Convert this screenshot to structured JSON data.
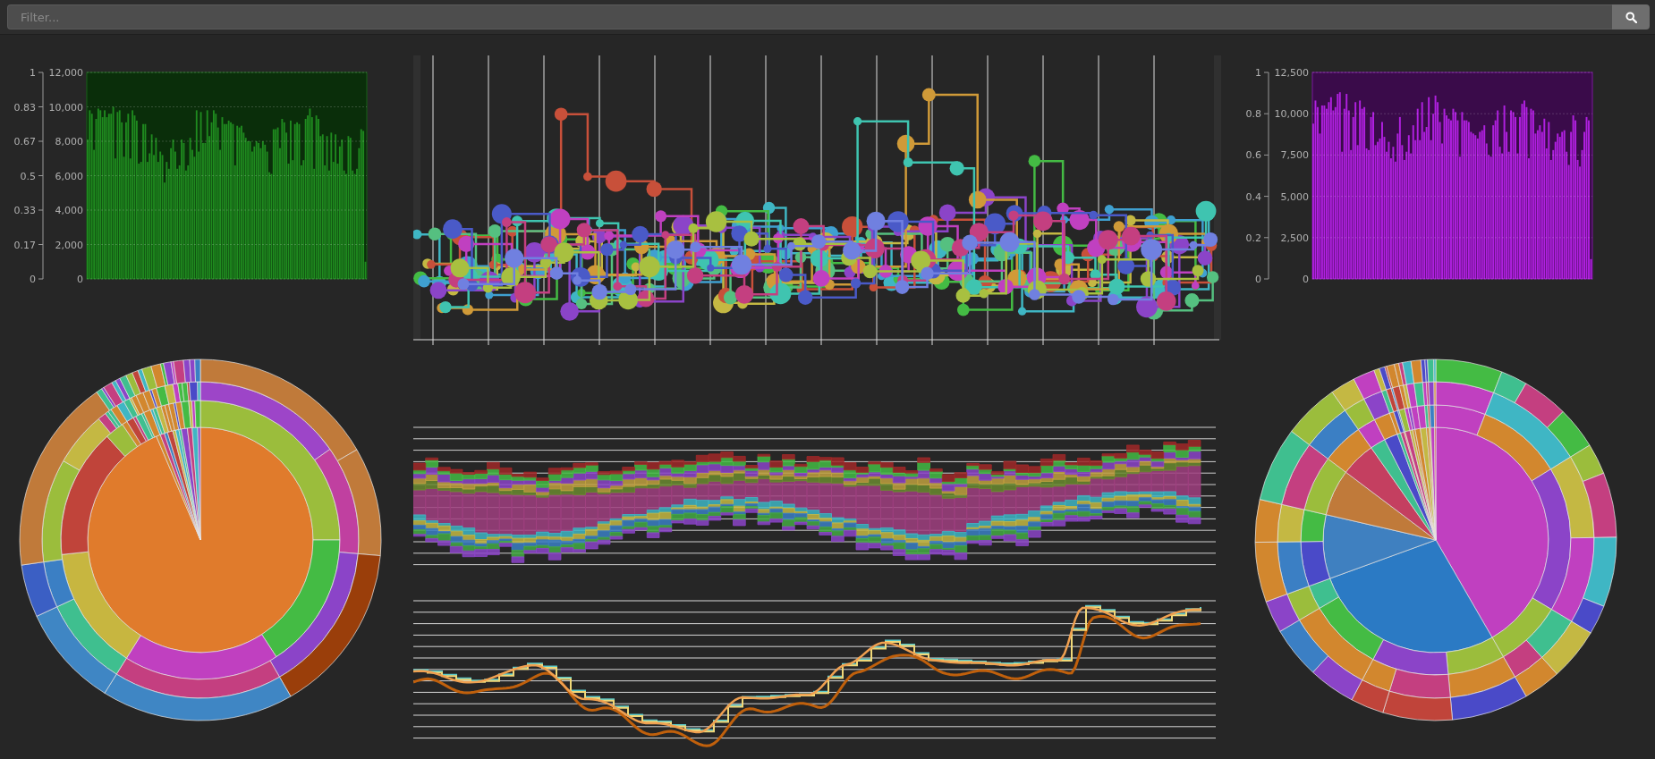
{
  "filter_bar": {
    "placeholder": "Filter..."
  },
  "bar_charts": [
    {
      "secondary_axis": {
        "ticks": [
          "1",
          "0.83",
          "0.67",
          "0.5",
          "0.33",
          "0.17",
          "0"
        ]
      },
      "chart_data": {
        "type": "bar",
        "grid": true,
        "ylim": [
          0,
          12000
        ],
        "yticks": [
          0,
          {
            "value": 2000,
            "label": "2,000"
          },
          {
            "value": 4000,
            "label": "4,000"
          },
          {
            "value": 6000,
            "label": "6,000"
          },
          {
            "value": 8000,
            "label": "8,000"
          },
          {
            "value": 10000,
            "label": "10,000"
          },
          {
            "value": 12000,
            "label": "12,000"
          }
        ],
        "series": [
          {
            "color": "#1f8a1f",
            "values": [
              8100,
              9800,
              9600,
              7500,
              9300,
              9900,
              9800,
              9400,
              9800,
              9400,
              9600,
              9600,
              10000,
              7000,
              9700,
              9800,
              9100,
              7100,
              9100,
              9600,
              7000,
              9800,
              9500,
              9200,
              6700,
              6800,
              9000,
              9000,
              6800,
              7300,
              8400,
              7200,
              8200,
              6800,
              7400,
              7200,
              5600,
              6800,
              6400,
              7600,
              8100,
              7400,
              6400,
              6600,
              8100,
              7900,
              6300,
              6600,
              8200,
              7500,
              7100,
              9800,
              7400,
              9700,
              7900,
              7900,
              9800,
              8300,
              9100,
              9800,
              9600,
              8800,
              7500,
              9400,
              9000,
              9000,
              9200,
              9100,
              9000,
              6600,
              8900,
              8800,
              8900,
              8500,
              8200,
              8000,
              8000,
              7400,
              7700,
              8000,
              7900,
              7600,
              8000,
              7800,
              7400,
              6200,
              6100,
              8700,
              8700,
              8800,
              7600,
              9300,
              9100,
              8500,
              6700,
              9200,
              6900,
              9000,
              9100,
              9000,
              6600,
              6900,
              9300,
              9500,
              9900,
              9400,
              6400,
              9500,
              9300,
              8300,
              8400,
              6600,
              8300,
              6300,
              8500,
              6800,
              8400,
              6700,
              7700,
              8100,
              6300,
              6100,
              8300,
              8200,
              6300,
              6100,
              6400,
              7600,
              8700,
              8600,
              1000
            ]
          }
        ]
      }
    },
    {
      "secondary_axis": {
        "ticks": [
          "1",
          "0.8",
          "0.6",
          "0.4",
          "0.2",
          "0"
        ]
      },
      "chart_data": {
        "type": "bar",
        "grid": true,
        "ylim": [
          0,
          12500
        ],
        "yticks": [
          0,
          {
            "value": 2500,
            "label": "2,500"
          },
          {
            "value": 5000,
            "label": "5,000"
          },
          {
            "value": 7500,
            "label": "7,500"
          },
          {
            "value": 10000,
            "label": "10,000"
          },
          {
            "value": 12500,
            "label": "12,500"
          }
        ],
        "series": [
          {
            "color": "#b020e0",
            "values": [
              9400,
              10800,
              10400,
              8800,
              10500,
              10500,
              10300,
              10700,
              11000,
              10200,
              10400,
              11200,
              11300,
              7700,
              10300,
              11200,
              10200,
              7800,
              9800,
              10700,
              8100,
              10800,
              10300,
              10400,
              7900,
              7800,
              9800,
              10100,
              8100,
              8300,
              8500,
              9500,
              8600,
              7700,
              8300,
              7300,
              8000,
              7100,
              8800,
              9800,
              8100,
              7200,
              7700,
              8700,
              7600,
              9300,
              8400,
              10300,
              8400,
              10700,
              8900,
              9200,
              11000,
              8400,
              10000,
              11100,
              10700,
              9500,
              8200,
              10300,
              9900,
              9700,
              9600,
              10300,
              10100,
              9600,
              7400,
              10100,
              9600,
              9600,
              9500,
              8900,
              8800,
              8700,
              8500,
              8900,
              9000,
              9300,
              8200,
              7500,
              7400,
              9300,
              9600,
              10200,
              8000,
              7600,
              10500,
              8900,
              7700,
              10200,
              10100,
              9800,
              7600,
              9800,
              10600,
              10800,
              10400,
              7300,
              10300,
              10200,
              8800,
              9000,
              9300,
              8900,
              9700,
              7900,
              9500,
              7200,
              7800,
              8300,
              8800,
              8600,
              8900,
              9000,
              7700,
              6900,
              8900,
              9900,
              9600,
              7200,
              6800,
              7800,
              8900,
              9800,
              9600,
              1200
            ]
          }
        ]
      }
    }
  ]
}
